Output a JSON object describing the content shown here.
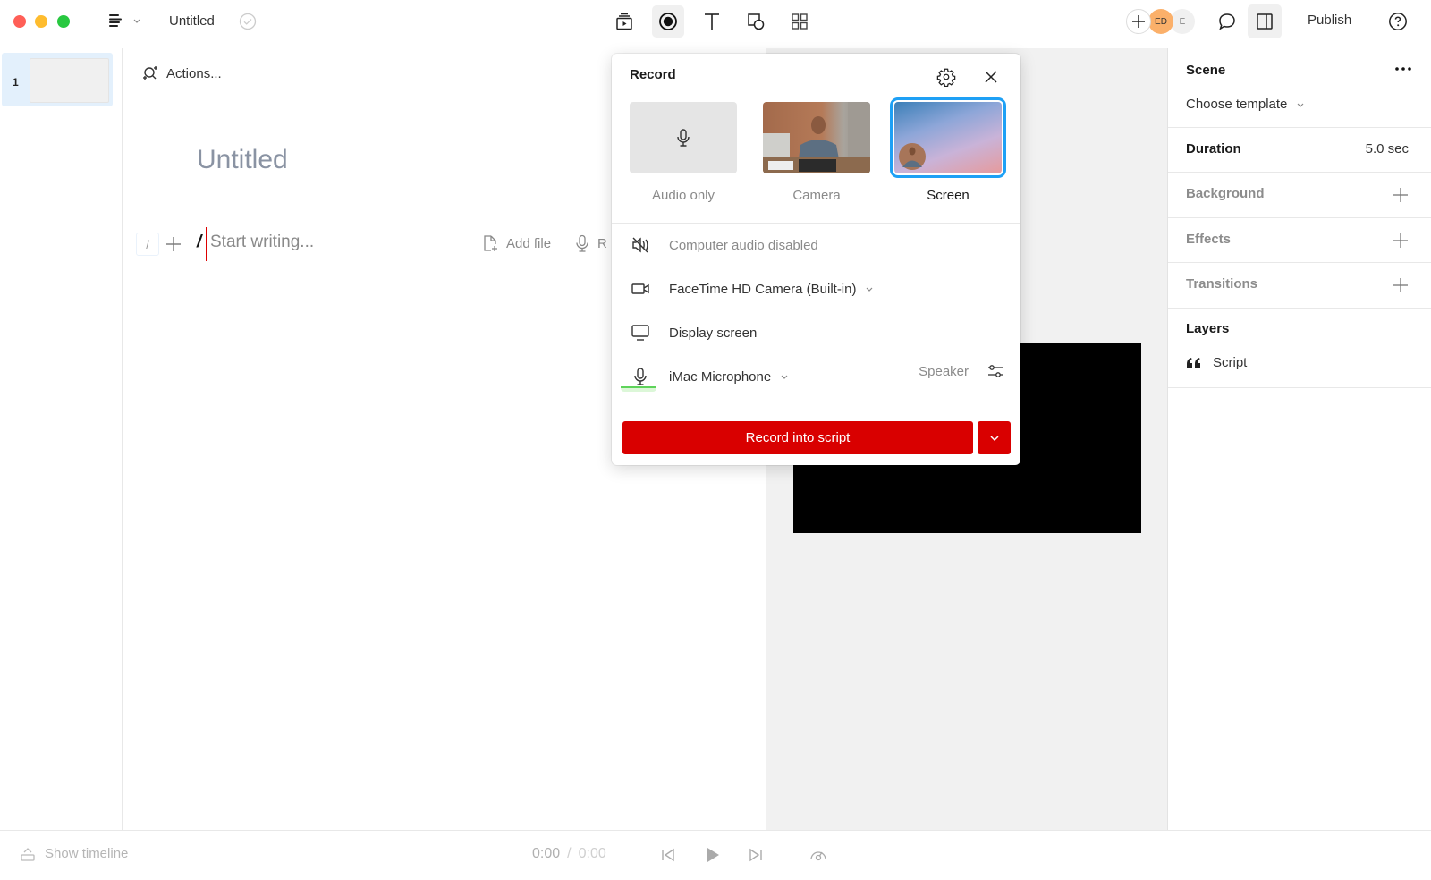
{
  "window": {
    "doc_title": "Untitled",
    "traffic_colors": {
      "close": "#ff5f57",
      "minimize": "#febc2e",
      "maximize": "#28c840"
    }
  },
  "toolbar": {
    "tools": [
      {
        "name": "scene",
        "icon": "scene-play-icon"
      },
      {
        "name": "record",
        "icon": "record-icon",
        "active": true
      },
      {
        "name": "text",
        "icon": "text-icon"
      },
      {
        "name": "shapes",
        "icon": "shapes-icon"
      },
      {
        "name": "grid",
        "icon": "grid-icon"
      }
    ],
    "collaborators": [
      "ED",
      "E"
    ],
    "publish_label": "Publish"
  },
  "thumbnails": [
    {
      "number": "1"
    }
  ],
  "editor": {
    "actions_label": "Actions...",
    "title": "Untitled",
    "slash_hint": "/",
    "slash_typed": "/",
    "placeholder": "Start writing...",
    "add_file_label": "Add file",
    "record_peek_label": "R"
  },
  "record_popover": {
    "title": "Record",
    "modes": [
      {
        "label": "Audio only",
        "selected": false
      },
      {
        "label": "Camera",
        "selected": false
      },
      {
        "label": "Screen",
        "selected": true
      }
    ],
    "options": {
      "computer_audio": "Computer audio disabled",
      "camera": "FaceTime HD Camera (Built-in)",
      "display": "Display screen",
      "microphone": "iMac Microphone",
      "speaker_label": "Speaker"
    },
    "record_button": "Record into script",
    "accent_color": "#d90000",
    "selected_color": "#1ea0f5"
  },
  "panel": {
    "scene_label": "Scene",
    "template_label": "Choose template",
    "duration_label": "Duration",
    "duration_value": "5.0 sec",
    "background_label": "Background",
    "effects_label": "Effects",
    "transitions_label": "Transitions",
    "layers_label": "Layers",
    "layers": [
      {
        "label": "Script",
        "icon": "quote-icon"
      }
    ]
  },
  "bottombar": {
    "show_timeline": "Show timeline",
    "current_time": "0:00",
    "separator": "/",
    "total_time": "0:00"
  }
}
